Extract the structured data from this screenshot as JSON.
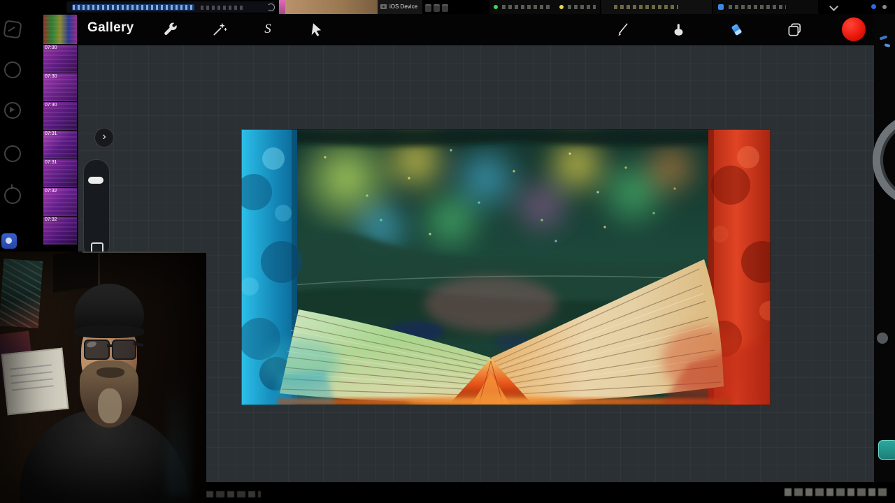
{
  "browser": {
    "ios_device_label": "iOS Device"
  },
  "procreate": {
    "gallery_label": "Gallery",
    "left_tools": [
      {
        "id": "actions",
        "label": "Actions",
        "icon": "wrench-icon"
      },
      {
        "id": "adjustments",
        "label": "Adjustments",
        "icon": "magic-wand-icon"
      },
      {
        "id": "selection",
        "label": "Selection",
        "icon": "selection-s-icon",
        "glyph": "S"
      },
      {
        "id": "transform",
        "label": "Transform",
        "icon": "arrow-cursor-icon"
      }
    ],
    "right_tools": [
      {
        "id": "paint",
        "label": "Paint",
        "icon": "brush-icon",
        "active": false
      },
      {
        "id": "smudge",
        "label": "Smudge",
        "icon": "smudge-finger-icon",
        "active": false
      },
      {
        "id": "erase",
        "label": "Erase",
        "icon": "eraser-icon",
        "active": true,
        "active_color": "#3f96ff"
      },
      {
        "id": "layers",
        "label": "Layers",
        "icon": "layers-icon",
        "active": false
      },
      {
        "id": "color",
        "label": "Color",
        "icon": "color-swatch-icon",
        "color": "#e81408"
      }
    ],
    "sidebar": {
      "chevron_glyph": "›"
    }
  },
  "recording_strip": {
    "items": [
      {
        "time": "07:30"
      },
      {
        "time": "07:30"
      },
      {
        "time": "07:30"
      },
      {
        "time": "07:31"
      },
      {
        "time": "07:31"
      },
      {
        "time": "07:32"
      },
      {
        "time": "07:32"
      }
    ]
  },
  "artwork": {
    "subject": "open book with glowing teal aurora forest scene above the pages",
    "palette": {
      "left_cover": "#23b2de",
      "right_cover": "#d93a20",
      "sky": "#1d4a3c",
      "pages": "#e8dcb4",
      "page_tint_left": "#7ac860",
      "page_tint_right": "#e8a050",
      "spine_ember": "#e85618"
    }
  },
  "webcam": {
    "subject": "streamer facecam: person with black beanie, glasses and beard"
  }
}
